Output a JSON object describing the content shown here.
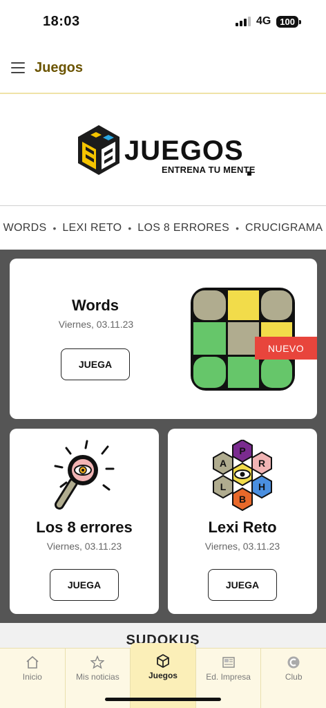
{
  "status": {
    "time": "18:03",
    "network": "4G",
    "battery": "100"
  },
  "header": {
    "title": "Juegos"
  },
  "logo": {
    "brand": "JUEGOS",
    "tagline": "ENTRENA TU MENTE"
  },
  "games_nav": [
    "WORDS",
    "LEXI RETO",
    "LOS 8 ERRORES",
    "CRUCIGRAMA"
  ],
  "cards": {
    "words": {
      "title": "Words",
      "date": "Viernes, 03.11.23",
      "button": "JUEGA",
      "badge": "NUEVO"
    },
    "errores": {
      "title": "Los 8 errores",
      "date": "Viernes, 03.11.23",
      "button": "JUEGA"
    },
    "lexi": {
      "title": "Lexi Reto",
      "date": "Viernes, 03.11.23",
      "button": "JUEGA",
      "letters": [
        "P",
        "A",
        "R",
        "L",
        "H",
        "B"
      ]
    }
  },
  "sudokus": {
    "title": "SUDOKUS"
  },
  "tabs": [
    {
      "label": "Inicio",
      "icon": "home-icon"
    },
    {
      "label": "Mis noticias",
      "icon": "star-icon"
    },
    {
      "label": "Juegos",
      "icon": "cube-icon",
      "active": true
    },
    {
      "label": "Ed. Impresa",
      "icon": "newspaper-icon"
    },
    {
      "label": "Club",
      "icon": "club-icon"
    }
  ],
  "colors": {
    "header_title": "#6b5400",
    "badge": "#e8453c",
    "tab_bar": "#fdf8e4",
    "cards_bg": "#555555"
  }
}
